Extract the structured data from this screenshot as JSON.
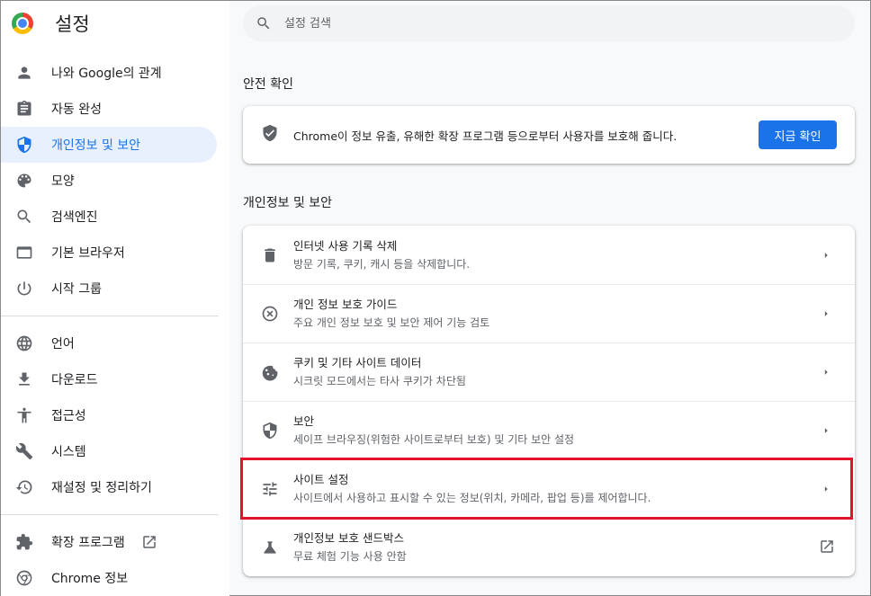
{
  "app": {
    "title": "설정"
  },
  "sidebar": {
    "items": [
      {
        "label": "나와 Google의 관계",
        "icon": "person-icon"
      },
      {
        "label": "자동 완성",
        "icon": "clipboard-icon"
      },
      {
        "label": "개인정보 및 보안",
        "icon": "shield-icon",
        "active": true
      },
      {
        "label": "모양",
        "icon": "palette-icon"
      },
      {
        "label": "검색엔진",
        "icon": "search-icon"
      },
      {
        "label": "기본 브라우저",
        "icon": "browser-icon"
      },
      {
        "label": "시작 그룹",
        "icon": "power-icon"
      }
    ],
    "advanced": [
      {
        "label": "언어",
        "icon": "globe-icon"
      },
      {
        "label": "다운로드",
        "icon": "download-icon"
      },
      {
        "label": "접근성",
        "icon": "accessibility-icon"
      },
      {
        "label": "시스템",
        "icon": "wrench-icon"
      },
      {
        "label": "재설정 및 정리하기",
        "icon": "restore-icon"
      }
    ],
    "extensions_label": "확장 프로그램",
    "about_label": "Chrome 정보"
  },
  "search": {
    "placeholder": "설정 검색"
  },
  "safety": {
    "section_title": "안전 확인",
    "text": "Chrome이 정보 유출, 유해한 확장 프로그램 등으로부터 사용자를 보호해 줍니다.",
    "button": "지금 확인"
  },
  "privacy": {
    "section_title": "개인정보 및 보안",
    "rows": [
      {
        "title": "인터넷 사용 기록 삭제",
        "sub": "방문 기록, 쿠키, 캐시 등을 삭제합니다.",
        "icon": "trash-icon"
      },
      {
        "title": "개인 정보 보호 가이드",
        "sub": "주요 개인 정보 보호 및 보안 제어 기능 검토",
        "icon": "guide-icon"
      },
      {
        "title": "쿠키 및 기타 사이트 데이터",
        "sub": "시크릿 모드에서는 타사 쿠키가 차단됨",
        "icon": "cookie-icon"
      },
      {
        "title": "보안",
        "sub": "세이프 브라우징(위험한 사이트로부터 보호) 및 기타 보안 설정",
        "icon": "security-icon"
      },
      {
        "title": "사이트 설정",
        "sub": "사이트에서 사용하고 표시할 수 있는 정보(위치, 카메라, 팝업 등)를 제어합니다.",
        "icon": "tune-icon"
      },
      {
        "title": "개인정보 보호 샌드박스",
        "sub": "무료 체험 기능 사용 안함",
        "icon": "flask-icon"
      }
    ]
  },
  "colors": {
    "accent": "#1a73e8",
    "highlight": "#e3132b",
    "active_bg": "#e8f0fe"
  }
}
